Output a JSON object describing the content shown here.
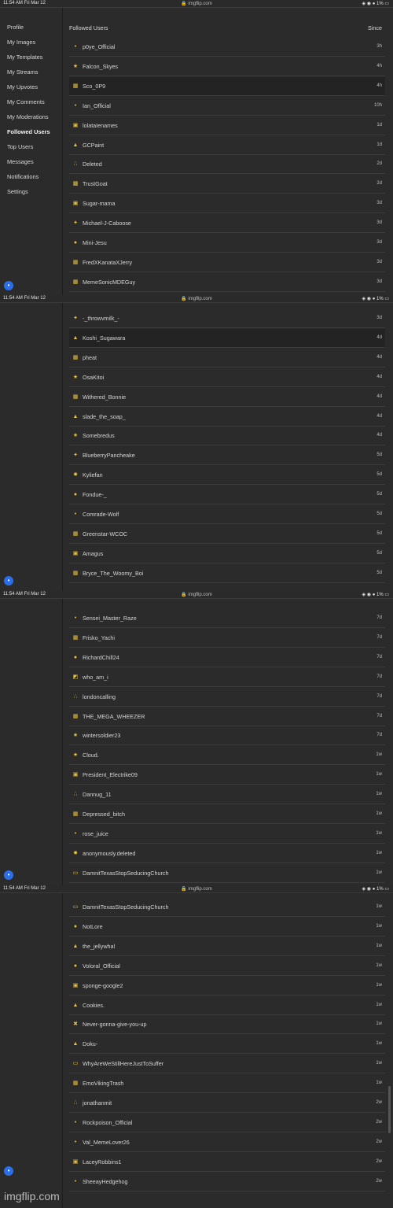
{
  "status": {
    "time": "11:54 AM",
    "date": "Fri Mar 12",
    "url": "imgflip.com",
    "system": "◈ ◉ ● 1% ▭"
  },
  "sidebar": {
    "items": [
      {
        "label": "Profile"
      },
      {
        "label": "My Images"
      },
      {
        "label": "My Templates"
      },
      {
        "label": "My Streams"
      },
      {
        "label": "My Upvotes"
      },
      {
        "label": "My Comments"
      },
      {
        "label": "My Moderations"
      },
      {
        "label": "Followed Users",
        "active": true
      },
      {
        "label": "Top Users"
      },
      {
        "label": "Messages"
      },
      {
        "label": "Notifications"
      },
      {
        "label": "Settings"
      }
    ]
  },
  "list": {
    "header": {
      "title": "Followed Users",
      "since": "Since"
    }
  },
  "screens": [
    {
      "rows": [
        {
          "name": "p0ye_Official",
          "time": "3h",
          "icon": "•"
        },
        {
          "name": "Falcon_Skyes",
          "time": "4h",
          "icon": "★"
        },
        {
          "name": "Sco_0P9",
          "time": "4h",
          "icon": "▦",
          "highlight": true
        },
        {
          "name": "Ian_Official",
          "time": "10h",
          "icon": "•"
        },
        {
          "name": "lolataIenames",
          "time": "1d",
          "icon": "▣"
        },
        {
          "name": "GCPaint",
          "time": "1d",
          "icon": "▲"
        },
        {
          "name": "Deleted",
          "time": "2d",
          "icon": "∴"
        },
        {
          "name": "TrustGoat",
          "time": "2d",
          "icon": "▩"
        },
        {
          "name": "Sugar-mama",
          "time": "3d",
          "icon": "▣"
        },
        {
          "name": "Michael-J-Caboose",
          "time": "3d",
          "icon": "✦"
        },
        {
          "name": "Mini-Jesu",
          "time": "3d",
          "icon": "●"
        },
        {
          "name": "FredXKanataXJerry",
          "time": "3d",
          "icon": "▦"
        },
        {
          "name": "MemeSonicMDEGuy",
          "time": "3d",
          "icon": "▦"
        }
      ]
    },
    {
      "rows": [
        {
          "name": "-_throwvmilk_-",
          "time": "3d",
          "icon": "✦"
        },
        {
          "name": "Koshi_Sugawara",
          "time": "4d",
          "icon": "▲",
          "highlight": true
        },
        {
          "name": "pheat",
          "time": "4d",
          "icon": "▦"
        },
        {
          "name": "OsaKitoi",
          "time": "4d",
          "icon": "★"
        },
        {
          "name": "Withered_Bonnie",
          "time": "4d",
          "icon": "▦"
        },
        {
          "name": "slade_the_soap_",
          "time": "4d",
          "icon": "▲"
        },
        {
          "name": "Somebredus",
          "time": "4d",
          "icon": "★"
        },
        {
          "name": "BlueberryPancheake",
          "time": "5d",
          "icon": "✦"
        },
        {
          "name": "Kyliefan",
          "time": "5d",
          "icon": "✹"
        },
        {
          "name": "Fondue-_",
          "time": "5d",
          "icon": "●"
        },
        {
          "name": "Comrade-Wolf",
          "time": "5d",
          "icon": "•"
        },
        {
          "name": "Greenstar-WCOC",
          "time": "5d",
          "icon": "▦"
        },
        {
          "name": "Amagus",
          "time": "5d",
          "icon": "▣"
        },
        {
          "name": "Bryce_The_Woomy_Boi",
          "time": "5d",
          "icon": "▦"
        }
      ]
    },
    {
      "rows": [
        {
          "name": "Sensei_Master_Raze",
          "time": "7d",
          "icon": "•"
        },
        {
          "name": "Frisko_Yachi",
          "time": "7d",
          "icon": "▦"
        },
        {
          "name": "RichardChill24",
          "time": "7d",
          "icon": "●"
        },
        {
          "name": "who_am_i",
          "time": "7d",
          "icon": "◩"
        },
        {
          "name": "londoncalling",
          "time": "7d",
          "icon": "∴"
        },
        {
          "name": "THE_MEGA_WHEEZER",
          "time": "7d",
          "icon": "▦"
        },
        {
          "name": "wintersoldier23",
          "time": "7d",
          "icon": "★"
        },
        {
          "name": "Cloud.",
          "time": "1w",
          "icon": "★"
        },
        {
          "name": "President_Electrike09",
          "time": "1w",
          "icon": "▣"
        },
        {
          "name": "Dannug_11",
          "time": "1w",
          "icon": "∴"
        },
        {
          "name": "Depressed_bitch",
          "time": "1w",
          "icon": "▦"
        },
        {
          "name": "rose_juice",
          "time": "1w",
          "icon": "•"
        },
        {
          "name": "anonymously.deleted",
          "time": "1w",
          "icon": "✹"
        },
        {
          "name": "DamnitTexasStopSeducingChurch",
          "time": "1w",
          "icon": "▭"
        }
      ]
    },
    {
      "rows": [
        {
          "name": "DamnitTexasStopSeducingChurch",
          "time": "1w",
          "icon": "▭"
        },
        {
          "name": "NotLore",
          "time": "1w",
          "icon": "●"
        },
        {
          "name": "the_jellywhal",
          "time": "1w",
          "icon": "▲"
        },
        {
          "name": "Voloral_Official",
          "time": "1w",
          "icon": "●"
        },
        {
          "name": "sponge-google2",
          "time": "1w",
          "icon": "▣"
        },
        {
          "name": "Cookies.",
          "time": "1w",
          "icon": "▲"
        },
        {
          "name": "Never-gonna-give-you-up",
          "time": "1w",
          "icon": "✖"
        },
        {
          "name": "Doku-",
          "time": "1w",
          "icon": "▲"
        },
        {
          "name": "WhyAreWeStillHereJustToSuffer",
          "time": "1w",
          "icon": "▭"
        },
        {
          "name": "EmoVikingTrash",
          "time": "1w",
          "icon": "▦"
        },
        {
          "name": "jonathanmit",
          "time": "2w",
          "icon": "∴"
        },
        {
          "name": "Rockpoison_Official",
          "time": "2w",
          "icon": "•"
        },
        {
          "name": "Val_MemeLover26",
          "time": "2w",
          "icon": "•"
        },
        {
          "name": "LaceyRobbins1",
          "time": "2w",
          "icon": "▣"
        },
        {
          "name": "SheeayHedgehog",
          "time": "2w",
          "icon": "•"
        }
      ]
    }
  ],
  "watermark": "imgflip.com",
  "colors": {
    "accent": "#2b6fe8",
    "highlight_row": "#232323",
    "background": "#2b2b2b"
  }
}
